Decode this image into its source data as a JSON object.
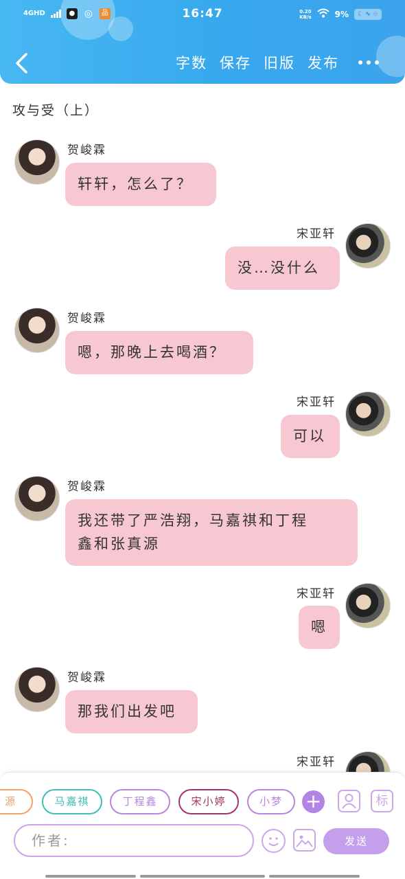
{
  "status_bar": {
    "network": "4GHD",
    "time": "16:47",
    "speed_value": "0.20",
    "speed_unit": "KB/s",
    "battery_percent": "9%"
  },
  "header": {
    "back_icon": "chevron-left-icon",
    "actions": [
      "字数",
      "保存",
      "旧版",
      "发布"
    ],
    "more_icon": "more-dots-icon"
  },
  "chapter_title": "攻与受（上）",
  "messages": [
    {
      "side": "left",
      "name": "贺峻霖",
      "lines": [
        "轩轩，怎么了？"
      ]
    },
    {
      "side": "right",
      "name": "宋亚轩",
      "lines": [
        "没…没什么"
      ]
    },
    {
      "side": "left",
      "name": "贺峻霖",
      "lines": [
        "嗯，那晚上去喝酒？"
      ]
    },
    {
      "side": "right",
      "name": "宋亚轩",
      "lines": [
        "可以"
      ]
    },
    {
      "side": "left",
      "name": "贺峻霖",
      "lines": [
        "我还带了严浩翔，马嘉祺和丁程",
        "鑫和张真源"
      ]
    },
    {
      "side": "right",
      "name": "宋亚轩",
      "lines": [
        "嗯"
      ]
    },
    {
      "side": "left",
      "name": "贺峻霖",
      "lines": [
        "那我们出发吧"
      ]
    },
    {
      "side": "right",
      "name": "宋亚轩",
      "lines": []
    }
  ],
  "composer": {
    "chips": [
      {
        "label": "源",
        "color": "#f3a06a"
      },
      {
        "label": "马嘉祺",
        "color": "#3dbfb4"
      },
      {
        "label": "丁程鑫",
        "color": "#b985df"
      },
      {
        "label": "宋小婷",
        "color": "#a3326a"
      },
      {
        "label": "小梦",
        "color": "#b985df"
      }
    ],
    "add_label": "+",
    "role_icon": "person-icon",
    "tag_label": "标",
    "input_placeholder": "作者:",
    "emoji_icon": "smiley-icon",
    "image_icon": "image-icon",
    "send_label": "发送"
  },
  "colors": {
    "header": "#3ba8ee",
    "bubble": "#f8c8d2",
    "accent": "#c4a0ec"
  }
}
